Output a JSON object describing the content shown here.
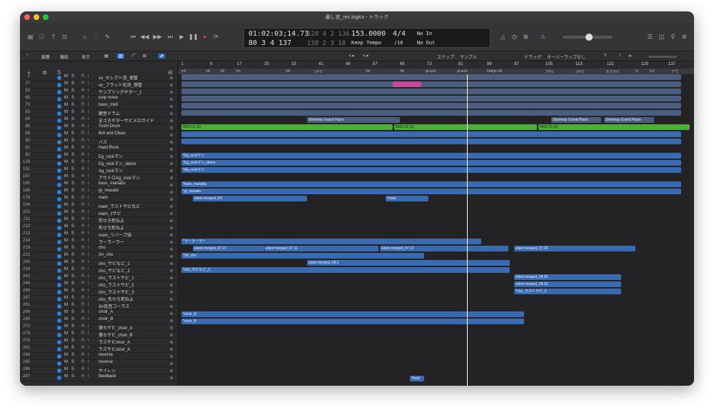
{
  "window": {
    "title": "最し言_rec.logicx - トラック"
  },
  "lcd": {
    "position": "01:02:03;14.73",
    "bars": "80  3  4  137",
    "sub_a": "128  4  2  136",
    "sub_b": "138  2  3  18",
    "tempo": "153.0000",
    "tempo_mode": "Keep Tempo",
    "signature": "4/4",
    "division": "/16",
    "in": "No In",
    "out": "No Out"
  },
  "subbar": {
    "edit": "編集",
    "function": "機能",
    "view": "表示",
    "snap_label": "スナップ:",
    "snap_value": "サンプル",
    "drag_label": "ドラッグ:",
    "drag_value": "オーバーラップなし"
  },
  "ruler": [
    "1",
    "9",
    "17",
    "25",
    "33",
    "41",
    "49",
    "57",
    "65",
    "73",
    "81",
    "89",
    "97",
    "105",
    "113",
    "121",
    "129",
    "137"
  ],
  "markers": [
    "in2",
    "1A",
    "1A'",
    "2in",
    "2A'",
    "1サビ",
    "2in",
    "3A",
    "gt.solo",
    "gt.solo",
    "bridge 4A",
    "2サビ",
    "2サビ",
    "ラスサビ",
    "9..",
    "in2",
    "アウ"
  ],
  "tracks": [
    {
      "num": "1",
      "name": "vo_セレクト済_保管"
    },
    {
      "num": "27",
      "name": "vo_フラット化済_保管"
    },
    {
      "num": "52",
      "name": "サンプリングギター_1"
    },
    {
      "num": "65",
      "name": "loop noise"
    },
    {
      "num": "73",
      "name": "bass_midi"
    },
    {
      "num": "83",
      "name": "鍵音ドラム"
    },
    {
      "num": "84",
      "name": "まさきギターサビメロガイド"
    },
    {
      "num": "85",
      "name": "Toshi Drum"
    },
    {
      "num": "89",
      "name": "Brit and Clean"
    },
    {
      "num": "90",
      "name": "バス"
    },
    {
      "num": "91",
      "name": "Hard Rock"
    },
    {
      "num": "92",
      "name": "Eg_rockマン"
    },
    {
      "num": "129",
      "name": "Eg_rockマン_demo"
    },
    {
      "num": "152",
      "name": "Ag_rockマン"
    },
    {
      "num": "157",
      "name": "アウトロAg_rockマン"
    },
    {
      "num": "160",
      "name": "bass_manabu"
    },
    {
      "num": "168",
      "name": "gt_masato"
    },
    {
      "num": "179",
      "name": "main"
    },
    {
      "num": "194",
      "name": "main_ラストサビなど"
    },
    {
      "num": "202",
      "name": "main_1サビ"
    },
    {
      "num": "211",
      "name": "失せろ死ねよ"
    },
    {
      "num": "212",
      "name": "失せろ死ねよ"
    },
    {
      "num": "213",
      "name": "main_リバーブ強"
    },
    {
      "num": "214",
      "name": "ラーラーラー"
    },
    {
      "num": "219",
      "name": "cho"
    },
    {
      "num": "221",
      "name": "3A_cho"
    },
    {
      "num": "230",
      "name": "cho_サビなど_1"
    },
    {
      "num": "234",
      "name": "cho_サビなど_2"
    },
    {
      "num": "242",
      "name": "cho_ラストサビ_1"
    },
    {
      "num": "246",
      "name": "cho_ラストサビ_2"
    },
    {
      "num": "249",
      "name": "cho_ラストサビ_3"
    },
    {
      "num": "257",
      "name": "cho_失せろ死ねよ"
    },
    {
      "num": "261",
      "name": "3A低音コーラス"
    },
    {
      "num": "266",
      "name": "choir_A"
    },
    {
      "num": "269",
      "name": "choir_B"
    },
    {
      "num": "272",
      "name": "落ちサビ_choir_A"
    },
    {
      "num": "275",
      "name": "落ちサビ_choir_B"
    },
    {
      "num": "278",
      "name": "ラスサビchoir_A"
    },
    {
      "num": "281",
      "name": "ラスサビchoir_A"
    },
    {
      "num": "284",
      "name": "reverse"
    },
    {
      "num": "285",
      "name": "reverse"
    },
    {
      "num": "286",
      "name": "サイレン"
    },
    {
      "num": "287",
      "name": "feedback"
    }
  ],
  "regions": {
    "toshi": "MIDI 01 (D)",
    "toshi2": "MIDI 01 (D)",
    "toshi3": "MIDI 01 (D)",
    "steinway1": "Steinway Grand Piano",
    "steinway2": "Steinway Grand Piano",
    "steinway3": "Steinway Grand Piano",
    "eg": "*Eg_rockマン",
    "eg_demo": "*Eg_rockマン_demo",
    "ag": "*Ag_rockマン",
    "bass": "*bass_manabu",
    "gt": "*gt_masato",
    "main_merged": "silent merged_D2",
    "main": "*main",
    "lara": "*ラーラーラー",
    "cho1": "silent merged_07.17",
    "cho2": "silent merged_07.11",
    "cho3": "silent merged_07.12",
    "cho4": "silent merged_07.26",
    "cho3a": "*3A_cho",
    "cho_sabi1": "silent merged_08.2",
    "cho_sabi2": "*cho_サビなど_2",
    "cho_last1": "silent merge",
    "cho_last2": "silent merged_08.25",
    "cho_last3": "silent merged_08.23",
    "cho_last4": "*cho_ラストサビ_3",
    "choirA": "*choir_A",
    "choirB": "*choir_B",
    "feedback": "*feed"
  }
}
